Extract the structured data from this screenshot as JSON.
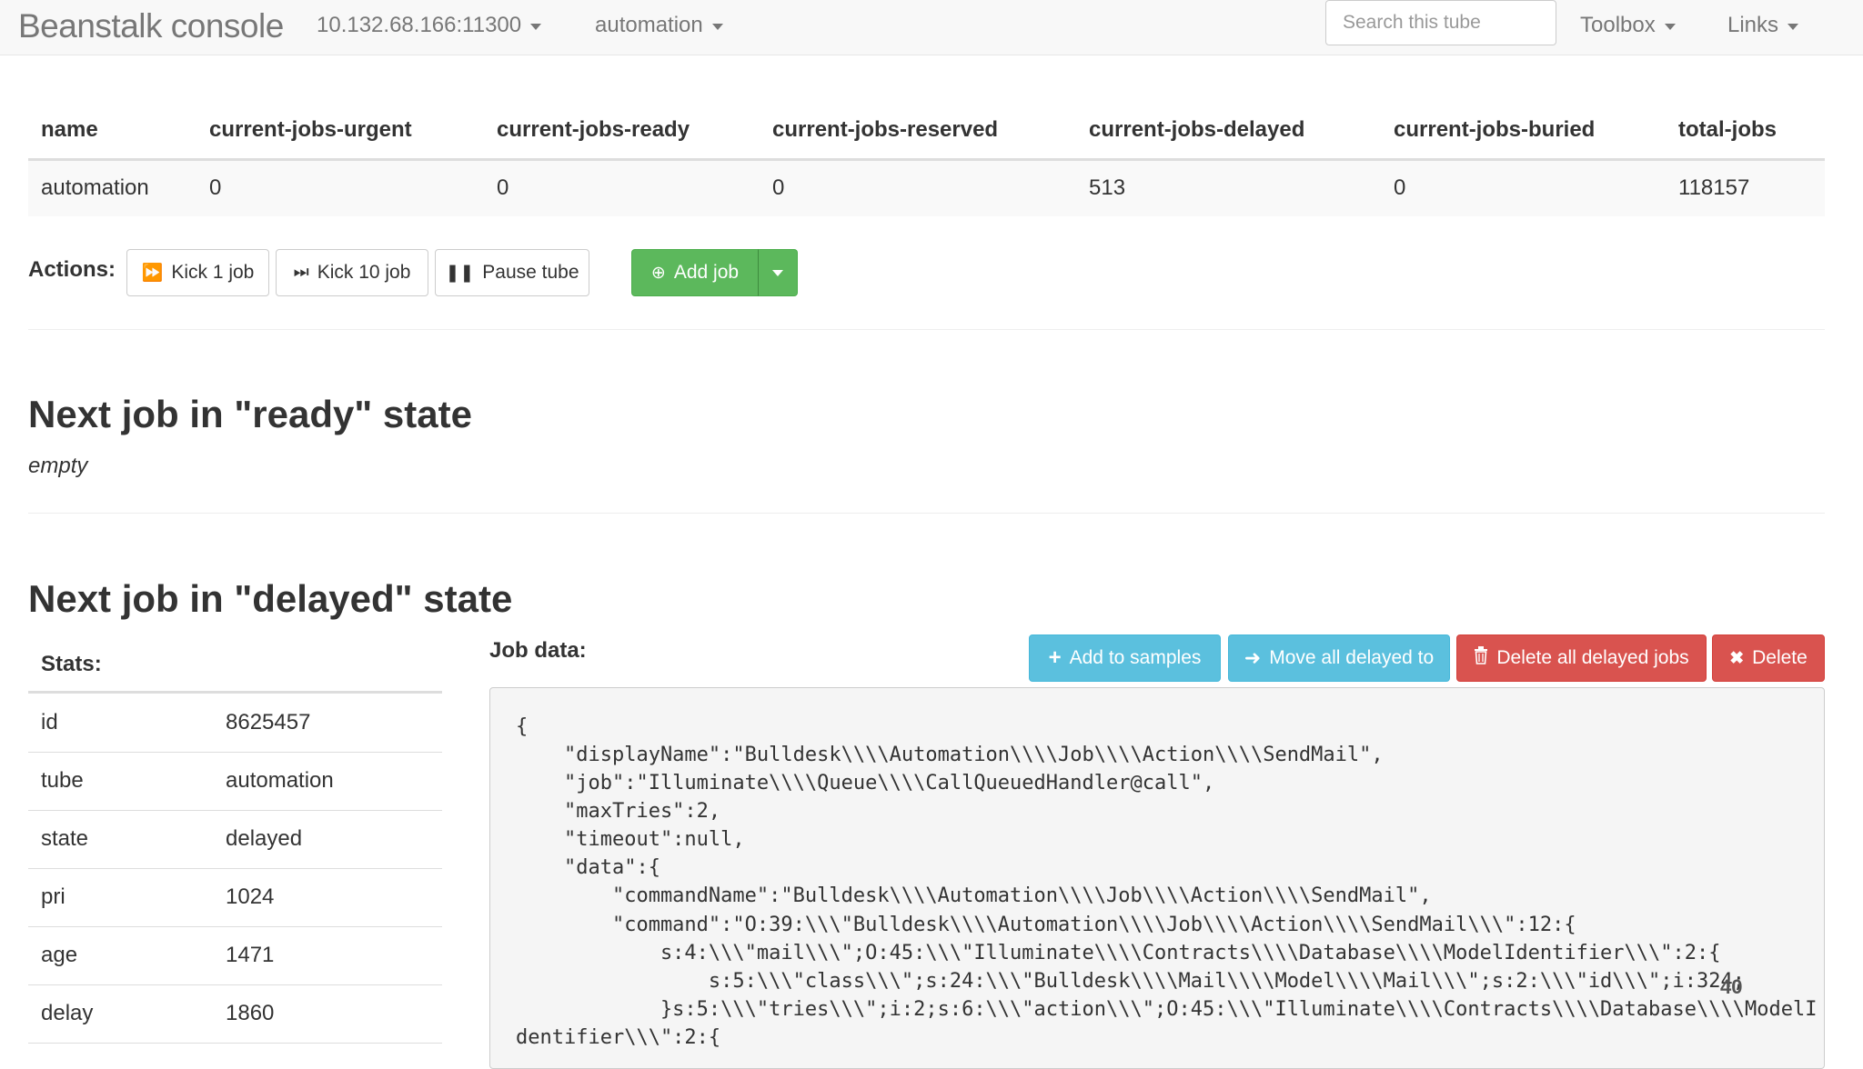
{
  "navbar": {
    "brand": "Beanstalk console",
    "server": "10.132.68.166:11300",
    "tube": "automation",
    "search_placeholder": "Search this tube",
    "toolbox": "Toolbox",
    "links": "Links"
  },
  "tube_stats": {
    "headers": [
      "name",
      "current-jobs-urgent",
      "current-jobs-ready",
      "current-jobs-reserved",
      "current-jobs-delayed",
      "current-jobs-buried",
      "total-jobs"
    ],
    "row": [
      "automation",
      "0",
      "0",
      "0",
      "513",
      "0",
      "118157"
    ]
  },
  "actions": {
    "label": "Actions:",
    "kick1": "Kick 1 job",
    "kick10": "Kick 10 job",
    "pause": "Pause tube",
    "add_job": "Add job"
  },
  "ready_section": {
    "title": "Next job in \"ready\" state",
    "empty": "empty"
  },
  "delayed_section": {
    "title": "Next job in \"delayed\" state",
    "stats_label": "Stats:",
    "stats": [
      {
        "key": "id",
        "value": "8625457"
      },
      {
        "key": "tube",
        "value": "automation"
      },
      {
        "key": "state",
        "value": "delayed"
      },
      {
        "key": "pri",
        "value": "1024"
      },
      {
        "key": "age",
        "value": "1471"
      },
      {
        "key": "delay",
        "value": "1860"
      }
    ],
    "job_data_label": "Job data:",
    "buttons": {
      "add_samples": "Add to samples",
      "move_delayed": "Move all delayed to",
      "delete_all": "Delete all delayed jobs",
      "delete": "Delete"
    },
    "code_lines": [
      "{",
      "    \"displayName\":\"Bulldesk\\\\\\\\Automation\\\\\\\\Job\\\\\\\\Action\\\\\\\\SendMail\",",
      "    \"job\":\"Illuminate\\\\\\\\Queue\\\\\\\\CallQueuedHandler@call\",",
      "    \"maxTries\":2,",
      "    \"timeout\":null,",
      "    \"data\":{",
      "        \"commandName\":\"Bulldesk\\\\\\\\Automation\\\\\\\\Job\\\\\\\\Action\\\\\\\\SendMail\",",
      "        \"command\":\"O:39:\\\\\\\"Bulldesk\\\\\\\\Automation\\\\\\\\Job\\\\\\\\Action\\\\\\\\SendMail\\\\\\\":12:{",
      "            s:4:\\\\\\\"mail\\\\\\\";O:45:\\\\\\\"Illuminate\\\\\\\\Contracts\\\\\\\\Database\\\\\\\\ModelIdentifier\\\\\\\":2:{",
      "                s:5:\\\\\\\"class\\\\\\\";s:24:\\\\\\\"Bulldesk\\\\\\\\Mail\\\\\\\\Model\\\\\\\\Mail\\\\\\\";s:2:\\\\\\\"id\\\\\\\";i:324;",
      "            }s:5:\\\\\\\"tries\\\\\\\";i:2;s:6:\\\\\\\"action\\\\\\\";O:45:\\\\\\\"Illuminate\\\\\\\\Contracts\\\\\\\\Database\\\\\\\\ModelI",
      "dentifier\\\\\\\":2:{"
    ],
    "line_badge": "40"
  }
}
